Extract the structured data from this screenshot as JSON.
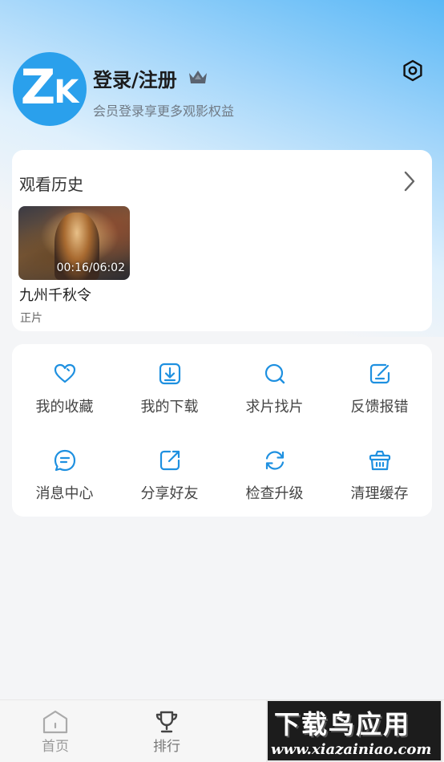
{
  "profile": {
    "title": "登录/注册",
    "subtitle": "会员登录享更多观影权益",
    "avatar_text_1": "Z",
    "avatar_text_2": "K",
    "crown_icon": "crown-icon",
    "settings_icon": "settings-hexagon-icon"
  },
  "history": {
    "title": "观看历史",
    "items": [
      {
        "title": "九州千秋令",
        "time": "00:16/06:02",
        "type": "正片"
      }
    ]
  },
  "actions": [
    {
      "label": "我的收藏",
      "icon": "heart-icon"
    },
    {
      "label": "我的下载",
      "icon": "download-icon"
    },
    {
      "label": "求片找片",
      "icon": "search-icon"
    },
    {
      "label": "反馈报错",
      "icon": "feedback-edit-icon"
    },
    {
      "label": "消息中心",
      "icon": "message-icon"
    },
    {
      "label": "分享好友",
      "icon": "share-icon"
    },
    {
      "label": "检查升级",
      "icon": "refresh-icon"
    },
    {
      "label": "清理缓存",
      "icon": "basket-icon"
    }
  ],
  "tabs": [
    {
      "label": "首页",
      "icon": "home-icon"
    },
    {
      "label": "排行",
      "icon": "trophy-icon"
    }
  ],
  "watermark": {
    "cn": "下载鸟应用",
    "url": "www.xiazainiao.com"
  },
  "colors": {
    "accent": "#2aa0ec",
    "icon_blue": "#1e90e0"
  }
}
